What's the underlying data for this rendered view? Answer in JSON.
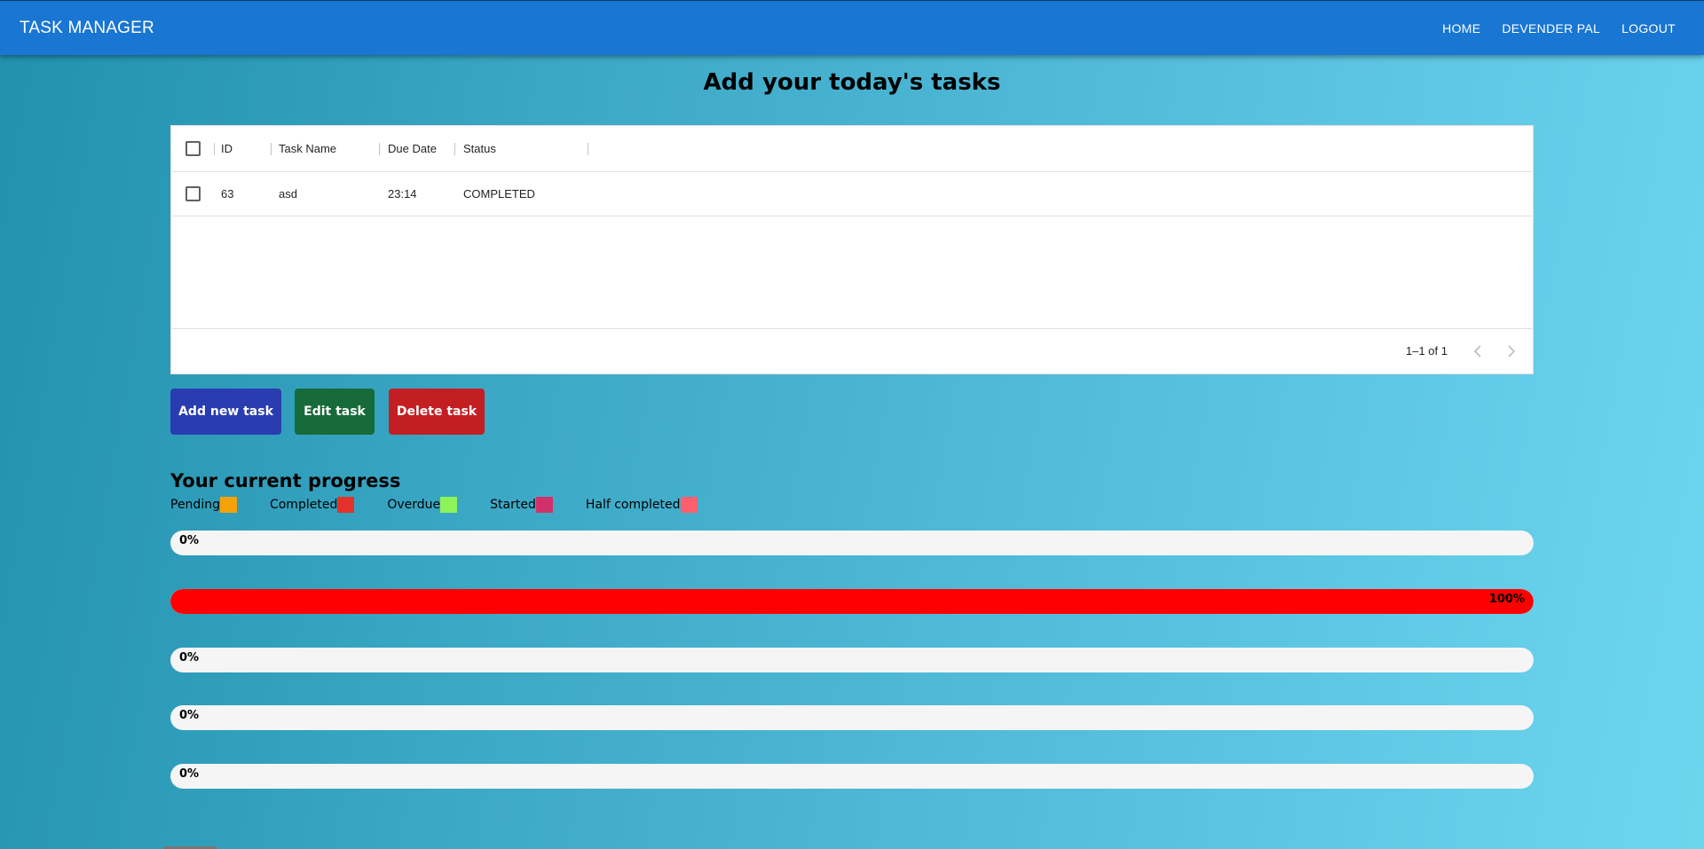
{
  "appbar": {
    "title": "TASK MANAGER",
    "nav": [
      "HOME",
      "DEVENDER PAL",
      "LOGOUT"
    ]
  },
  "page_title": "Add your today's tasks",
  "grid": {
    "columns": [
      "ID",
      "Task Name",
      "Due Date",
      "Status"
    ],
    "rows": [
      {
        "id": "63",
        "name": "asd",
        "due": "23:14",
        "status": "COMPLETED"
      }
    ],
    "pagination": "1–1 of 1"
  },
  "actions": {
    "add": "Add new task",
    "edit": "Edit task",
    "delete": "Delete task",
    "colors": {
      "add": "#2a3db0",
      "edit": "#176b3a",
      "delete": "#c31f23"
    }
  },
  "progress": {
    "title": "Your current progress",
    "legend": [
      {
        "label": "Pending",
        "color": "#f5a10a"
      },
      {
        "label": "Completed",
        "color": "#e5312b"
      },
      {
        "label": "Overdue",
        "color": "#8ef25a"
      },
      {
        "label": "Started",
        "color": "#d1316a"
      },
      {
        "label": "Half completed",
        "color": "#ff5f6d"
      }
    ],
    "bars": [
      {
        "label": "0%",
        "percent": 0,
        "color": "#f5a10a"
      },
      {
        "label": "100%",
        "percent": 100,
        "color": "#ff0000"
      },
      {
        "label": "0%",
        "percent": 0,
        "color": "#8ef25a"
      },
      {
        "label": "0%",
        "percent": 0,
        "color": "#d1316a"
      },
      {
        "label": "0%",
        "percent": 0,
        "color": "#ff5f6d"
      }
    ]
  }
}
